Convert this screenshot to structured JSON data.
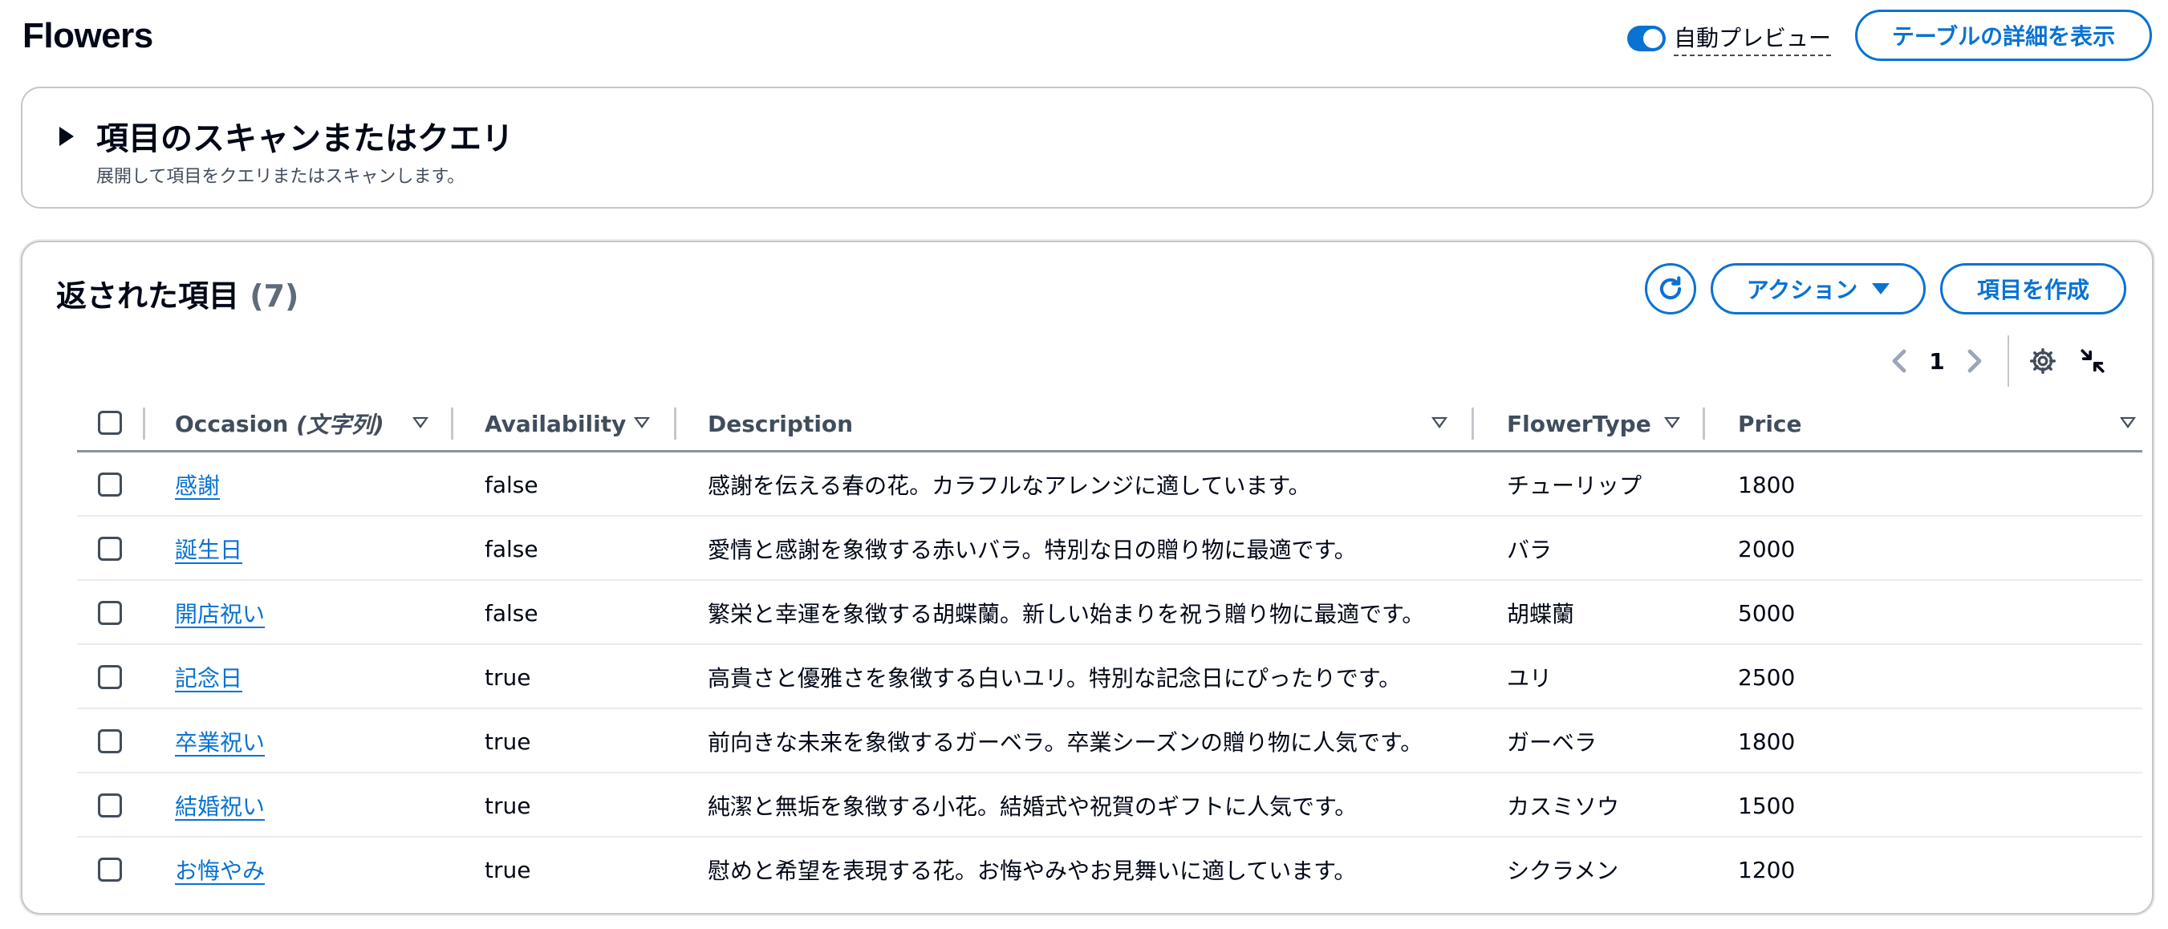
{
  "header": {
    "title": "Flowers",
    "auto_preview_label": "自動プレビュー",
    "auto_preview_enabled": true,
    "details_button": "テーブルの詳細を表示"
  },
  "scan_panel": {
    "title": "項目のスキャンまたはクエリ",
    "subtitle": "展開して項目をクエリまたはスキャンします。"
  },
  "results": {
    "title": "返された項目",
    "count": "(7)",
    "actions_button": "アクション",
    "create_button": "項目を作成",
    "page_number": "1",
    "columns": {
      "occasion": "Occasion",
      "occasion_type": "(文字列)",
      "availability": "Availability",
      "description": "Description",
      "flower_type": "FlowerType",
      "price": "Price"
    },
    "rows": [
      {
        "occasion": "感謝",
        "availability": "false",
        "description": "感謝を伝える春の花。カラフルなアレンジに適しています。",
        "flower_type": "チューリップ",
        "price": "1800"
      },
      {
        "occasion": "誕生日",
        "availability": "false",
        "description": "愛情と感謝を象徴する赤いバラ。特別な日の贈り物に最適です。",
        "flower_type": "バラ",
        "price": "2000"
      },
      {
        "occasion": "開店祝い",
        "availability": "false",
        "description": "繁栄と幸運を象徴する胡蝶蘭。新しい始まりを祝う贈り物に最適です。",
        "flower_type": "胡蝶蘭",
        "price": "5000"
      },
      {
        "occasion": "記念日",
        "availability": "true",
        "description": "高貴さと優雅さを象徴する白いユリ。特別な記念日にぴったりです。",
        "flower_type": "ユリ",
        "price": "2500"
      },
      {
        "occasion": "卒業祝い",
        "availability": "true",
        "description": "前向きな未来を象徴するガーベラ。卒業シーズンの贈り物に人気です。",
        "flower_type": "ガーベラ",
        "price": "1800"
      },
      {
        "occasion": "結婚祝い",
        "availability": "true",
        "description": "純潔と無垢を象徴する小花。結婚式や祝賀のギフトに人気です。",
        "flower_type": "カスミソウ",
        "price": "1500"
      },
      {
        "occasion": "お悔やみ",
        "availability": "true",
        "description": "慰めと希望を表現する花。お悔やみやお見舞いに適しています。",
        "flower_type": "シクラメン",
        "price": "1200"
      }
    ]
  },
  "colors": {
    "accent": "#0972d3",
    "text": "#000716",
    "muted": "#414d5c",
    "border": "#c6c6cd"
  }
}
